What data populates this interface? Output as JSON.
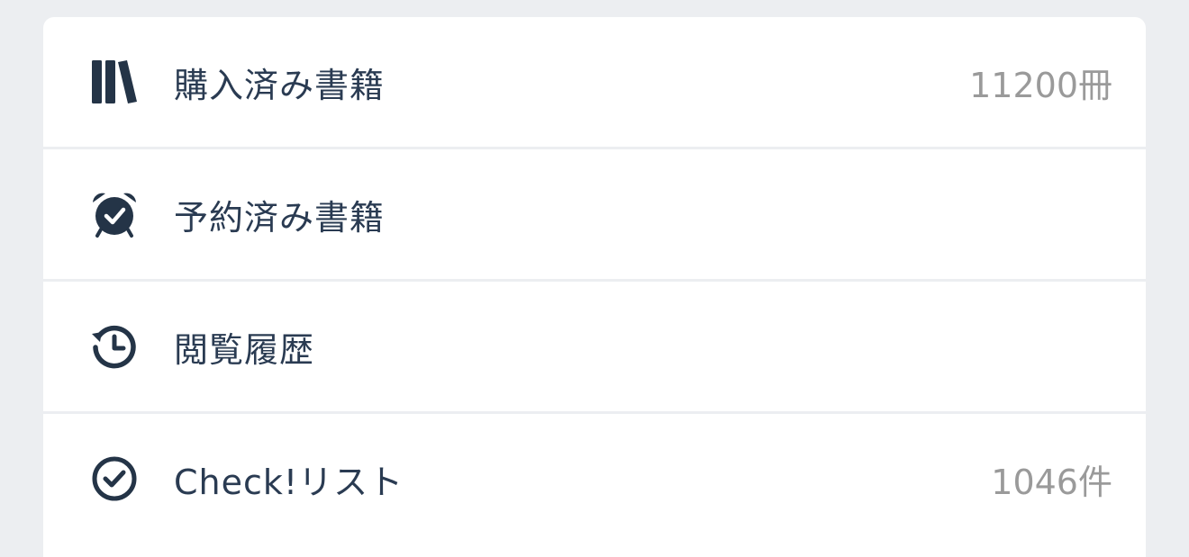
{
  "menu": {
    "items": [
      {
        "label": "購入済み書籍",
        "count": "11200冊",
        "icon": "bookshelf-icon"
      },
      {
        "label": "予約済み書籍",
        "count": "",
        "icon": "alarm-clock-icon"
      },
      {
        "label": "閲覧履歴",
        "count": "",
        "icon": "history-icon"
      },
      {
        "label": "Check!リスト",
        "count": "1046件",
        "icon": "check-circle-icon"
      }
    ]
  },
  "colors": {
    "background": "#eceef1",
    "card": "#ffffff",
    "text": "#2a3b52",
    "icon": "#243447",
    "count": "#9a9a9a"
  }
}
